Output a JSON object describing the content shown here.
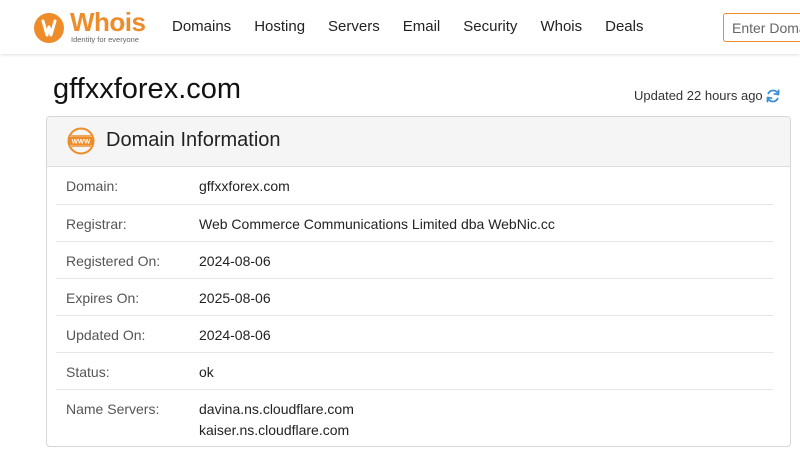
{
  "header": {
    "logo": {
      "text": "Whois",
      "tagline": "Identity for everyone",
      "accent_color": "#ef8c2a"
    },
    "nav": [
      "Domains",
      "Hosting",
      "Servers",
      "Email",
      "Security",
      "Whois",
      "Deals"
    ],
    "search": {
      "placeholder": "Enter Domain"
    }
  },
  "page": {
    "domain_title": "gffxxforex.com",
    "updated_text": "Updated 22 hours ago",
    "refresh_icon": "refresh-icon",
    "refresh_color": "#3a8fd6"
  },
  "card": {
    "icon": "www-icon",
    "title": "Domain Information",
    "rows": [
      {
        "label": "Domain:",
        "value": "gffxxforex.com"
      },
      {
        "label": "Registrar:",
        "value": "Web Commerce Communications Limited dba WebNic.cc"
      },
      {
        "label": "Registered On:",
        "value": "2024-08-06"
      },
      {
        "label": "Expires On:",
        "value": "2025-08-06"
      },
      {
        "label": "Updated On:",
        "value": "2024-08-06"
      },
      {
        "label": "Status:",
        "value": "ok"
      },
      {
        "label": "Name Servers:",
        "values": [
          "davina.ns.cloudflare.com",
          "kaiser.ns.cloudflare.com"
        ]
      }
    ]
  }
}
